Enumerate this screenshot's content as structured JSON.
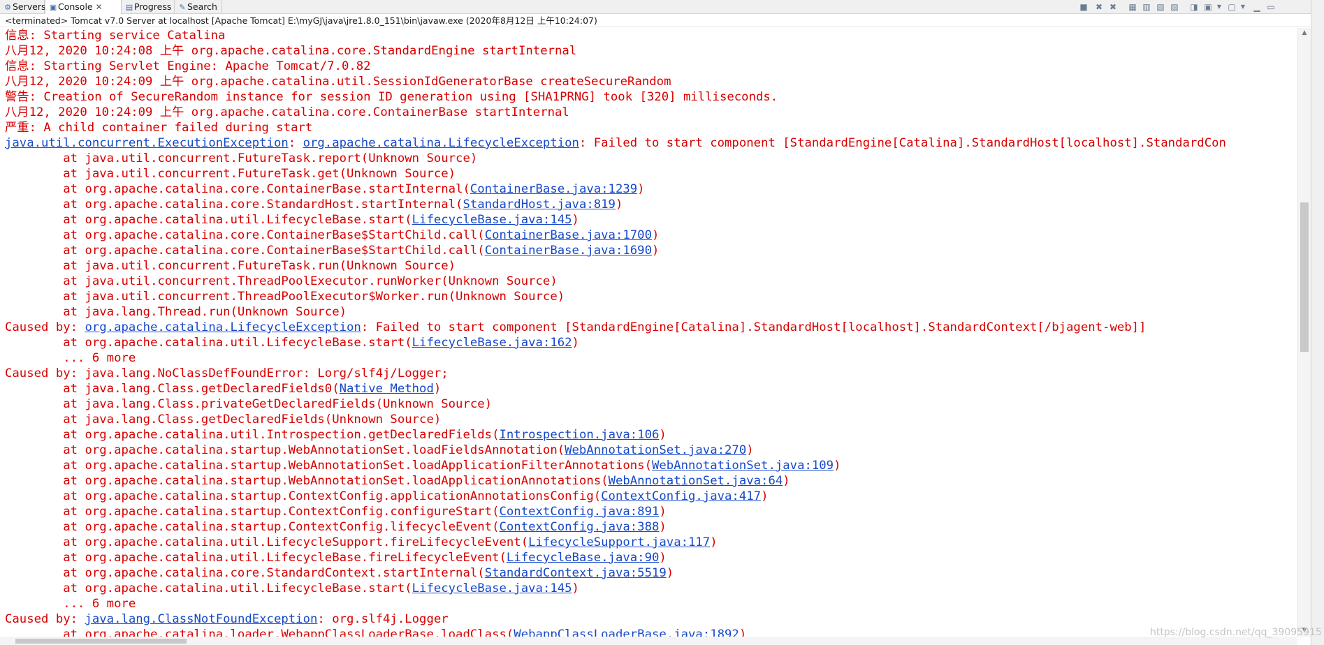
{
  "tabs": [
    {
      "label": "Servers",
      "icon": "servers-icon"
    },
    {
      "label": "Console",
      "icon": "console-icon",
      "active": true
    },
    {
      "label": "Progress",
      "icon": "progress-icon"
    },
    {
      "label": "Search",
      "icon": "search-icon"
    }
  ],
  "toolbar_icons": [
    "terminate-icon",
    "remove-launch-icon",
    "remove-all-terminated-icon",
    "clear-console-icon",
    "scroll-lock-icon",
    "word-wrap-icon",
    "show-console-on-output-icon",
    "pin-console-icon",
    "display-selected-console-icon",
    "open-console-icon",
    "minimize-icon",
    "maximize-icon"
  ],
  "status_text": "<terminated> Tomcat v7.0 Server at localhost [Apache Tomcat] E:\\myGJ\\java\\jre1.8.0_151\\bin\\javaw.exe (2020年8月12日 上午10:24:07)",
  "colors": {
    "error_text": "#d80000",
    "link": "#1648c8"
  },
  "console_lines": [
    [
      {
        "t": "信息: Starting service Catalina"
      }
    ],
    [
      {
        "t": "八月12, 2020 10:24:08 上午 org.apache.catalina.core.StandardEngine startInternal"
      }
    ],
    [
      {
        "t": "信息: Starting Servlet Engine: Apache Tomcat/7.0.82"
      }
    ],
    [
      {
        "t": "八月12, 2020 10:24:09 上午 org.apache.catalina.util.SessionIdGeneratorBase createSecureRandom"
      }
    ],
    [
      {
        "t": "警告: Creation of SecureRandom instance for session ID generation using [SHA1PRNG] took [320] milliseconds."
      }
    ],
    [
      {
        "t": "八月12, 2020 10:24:09 上午 org.apache.catalina.core.ContainerBase startInternal"
      }
    ],
    [
      {
        "t": "严重: A child container failed during start"
      }
    ],
    [
      {
        "t": "java.util.concurrent.ExecutionException",
        "link": true
      },
      {
        "t": ": "
      },
      {
        "t": "org.apache.catalina.LifecycleException",
        "link": true
      },
      {
        "t": ": Failed to start component [StandardEngine[Catalina].StandardHost[localhost].StandardCon"
      }
    ],
    [
      {
        "t": "\tat java.util.concurrent.FutureTask.report(Unknown Source)"
      }
    ],
    [
      {
        "t": "\tat java.util.concurrent.FutureTask.get(Unknown Source)"
      }
    ],
    [
      {
        "t": "\tat org.apache.catalina.core.ContainerBase.startInternal("
      },
      {
        "t": "ContainerBase.java:1239",
        "link": true
      },
      {
        "t": ")"
      }
    ],
    [
      {
        "t": "\tat org.apache.catalina.core.StandardHost.startInternal("
      },
      {
        "t": "StandardHost.java:819",
        "link": true
      },
      {
        "t": ")"
      }
    ],
    [
      {
        "t": "\tat org.apache.catalina.util.LifecycleBase.start("
      },
      {
        "t": "LifecycleBase.java:145",
        "link": true
      },
      {
        "t": ")"
      }
    ],
    [
      {
        "t": "\tat org.apache.catalina.core.ContainerBase$StartChild.call("
      },
      {
        "t": "ContainerBase.java:1700",
        "link": true
      },
      {
        "t": ")"
      }
    ],
    [
      {
        "t": "\tat org.apache.catalina.core.ContainerBase$StartChild.call("
      },
      {
        "t": "ContainerBase.java:1690",
        "link": true
      },
      {
        "t": ")"
      }
    ],
    [
      {
        "t": "\tat java.util.concurrent.FutureTask.run(Unknown Source)"
      }
    ],
    [
      {
        "t": "\tat java.util.concurrent.ThreadPoolExecutor.runWorker(Unknown Source)"
      }
    ],
    [
      {
        "t": "\tat java.util.concurrent.ThreadPoolExecutor$Worker.run(Unknown Source)"
      }
    ],
    [
      {
        "t": "\tat java.lang.Thread.run(Unknown Source)"
      }
    ],
    [
      {
        "t": "Caused by: "
      },
      {
        "t": "org.apache.catalina.LifecycleException",
        "link": true
      },
      {
        "t": ": Failed to start component [StandardEngine[Catalina].StandardHost[localhost].StandardContext[/bjagent-web]]"
      }
    ],
    [
      {
        "t": "\tat org.apache.catalina.util.LifecycleBase.start("
      },
      {
        "t": "LifecycleBase.java:162",
        "link": true
      },
      {
        "t": ")"
      }
    ],
    [
      {
        "t": "\t... 6 more"
      }
    ],
    [
      {
        "t": "Caused by: java.lang.NoClassDefFoundError: Lorg/slf4j/Logger;"
      }
    ],
    [
      {
        "t": "\tat java.lang.Class.getDeclaredFields0("
      },
      {
        "t": "Native Method",
        "link": true
      },
      {
        "t": ")"
      }
    ],
    [
      {
        "t": "\tat java.lang.Class.privateGetDeclaredFields(Unknown Source)"
      }
    ],
    [
      {
        "t": "\tat java.lang.Class.getDeclaredFields(Unknown Source)"
      }
    ],
    [
      {
        "t": "\tat org.apache.catalina.util.Introspection.getDeclaredFields("
      },
      {
        "t": "Introspection.java:106",
        "link": true
      },
      {
        "t": ")"
      }
    ],
    [
      {
        "t": "\tat org.apache.catalina.startup.WebAnnotationSet.loadFieldsAnnotation("
      },
      {
        "t": "WebAnnotationSet.java:270",
        "link": true
      },
      {
        "t": ")"
      }
    ],
    [
      {
        "t": "\tat org.apache.catalina.startup.WebAnnotationSet.loadApplicationFilterAnnotations("
      },
      {
        "t": "WebAnnotationSet.java:109",
        "link": true
      },
      {
        "t": ")"
      }
    ],
    [
      {
        "t": "\tat org.apache.catalina.startup.WebAnnotationSet.loadApplicationAnnotations("
      },
      {
        "t": "WebAnnotationSet.java:64",
        "link": true
      },
      {
        "t": ")"
      }
    ],
    [
      {
        "t": "\tat org.apache.catalina.startup.ContextConfig.applicationAnnotationsConfig("
      },
      {
        "t": "ContextConfig.java:417",
        "link": true
      },
      {
        "t": ")"
      }
    ],
    [
      {
        "t": "\tat org.apache.catalina.startup.ContextConfig.configureStart("
      },
      {
        "t": "ContextConfig.java:891",
        "link": true
      },
      {
        "t": ")"
      }
    ],
    [
      {
        "t": "\tat org.apache.catalina.startup.ContextConfig.lifecycleEvent("
      },
      {
        "t": "ContextConfig.java:388",
        "link": true
      },
      {
        "t": ")"
      }
    ],
    [
      {
        "t": "\tat org.apache.catalina.util.LifecycleSupport.fireLifecycleEvent("
      },
      {
        "t": "LifecycleSupport.java:117",
        "link": true
      },
      {
        "t": ")"
      }
    ],
    [
      {
        "t": "\tat org.apache.catalina.util.LifecycleBase.fireLifecycleEvent("
      },
      {
        "t": "LifecycleBase.java:90",
        "link": true
      },
      {
        "t": ")"
      }
    ],
    [
      {
        "t": "\tat org.apache.catalina.core.StandardContext.startInternal("
      },
      {
        "t": "StandardContext.java:5519",
        "link": true
      },
      {
        "t": ")"
      }
    ],
    [
      {
        "t": "\tat org.apache.catalina.util.LifecycleBase.start("
      },
      {
        "t": "LifecycleBase.java:145",
        "link": true
      },
      {
        "t": ")"
      }
    ],
    [
      {
        "t": "\t... 6 more"
      }
    ],
    [
      {
        "t": "Caused by: "
      },
      {
        "t": "java.lang.ClassNotFoundException",
        "link": true
      },
      {
        "t": ": org.slf4j.Logger"
      }
    ],
    [
      {
        "t": "\tat org.apache.catalina.loader.WebappClassLoaderBase.loadClass("
      },
      {
        "t": "WebappClassLoaderBase.java:1892",
        "link": true
      },
      {
        "t": ")"
      }
    ]
  ],
  "watermark": "https://blog.csdn.net/qq_39095915"
}
